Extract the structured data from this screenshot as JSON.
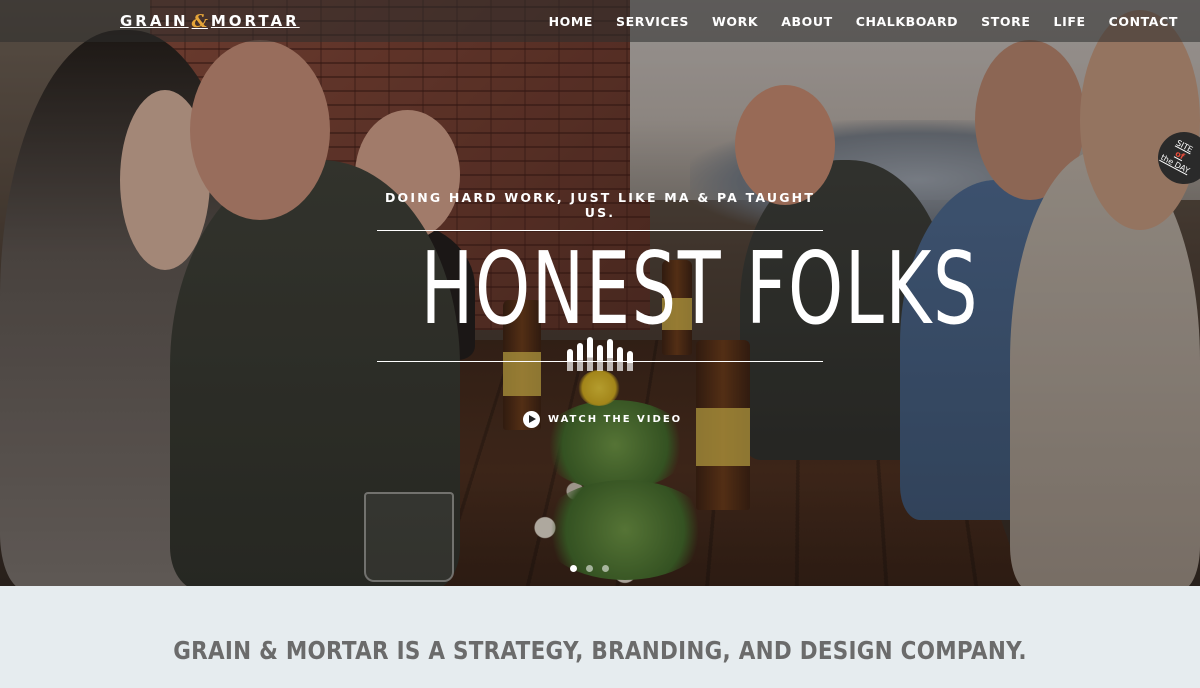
{
  "brand": {
    "logo_left": "GRAIN",
    "logo_amp": "&",
    "logo_right": "MORTAR",
    "accent": "#e4a43a"
  },
  "nav": {
    "items": [
      {
        "label": "HOME"
      },
      {
        "label": "SERVICES"
      },
      {
        "label": "WORK"
      },
      {
        "label": "ABOUT"
      },
      {
        "label": "CHALKBOARD"
      },
      {
        "label": "STORE"
      },
      {
        "label": "LIFE"
      },
      {
        "label": "CONTACT"
      }
    ]
  },
  "hero": {
    "tagline": "DOING HARD WORK, JUST LIKE MA & PA TAUGHT US.",
    "headline": "HONEST FOLKS",
    "watch_label": "WATCH THE VIDEO",
    "slides": {
      "count": 3,
      "active": 1
    }
  },
  "badge": {
    "top": "SITE",
    "mid": "of",
    "bottom": "the DAY"
  },
  "intro": {
    "title": "GRAIN & MORTAR IS A STRATEGY, BRANDING, AND DESIGN COMPANY."
  }
}
